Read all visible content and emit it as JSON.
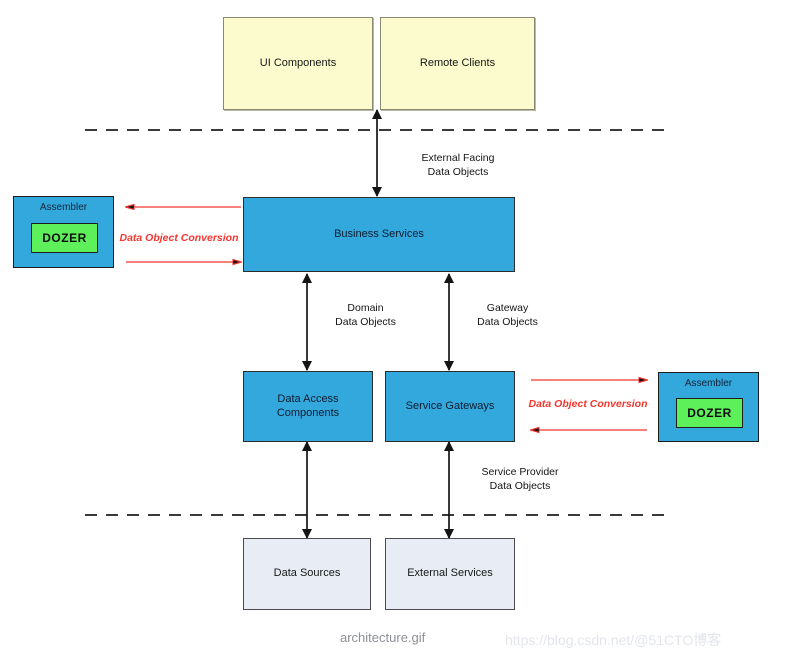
{
  "diagram": {
    "title": "architecture.gif",
    "watermark": "https://blog.csdn.net/@51CTO博客",
    "colors": {
      "yellow_node": "#fbfbcd",
      "blue_node": "#32a8dd",
      "grey_node": "#e7ecf5",
      "dozer_green": "#5ef05a",
      "conversion_red": "#f4362f",
      "connector_black": "#141414",
      "divider_grey": "#3a3a3a"
    },
    "nodes": {
      "ui_components": "UI Components",
      "remote_clients": "Remote Clients",
      "business_services": "Business Services",
      "data_access_components": "Data Access\nComponents",
      "service_gateways": "Service Gateways",
      "data_sources": "Data Sources",
      "external_services": "External Services"
    },
    "assemblers": {
      "left": {
        "title": "Assembler",
        "tool": "DOZER",
        "conversion_label": "Data Object Conversion"
      },
      "right": {
        "title": "Assembler",
        "tool": "DOZER",
        "conversion_label": "Data Object Conversion"
      }
    },
    "connector_labels": {
      "external_facing": "External Facing\nData Objects",
      "domain": "Domain\nData Objects",
      "gateway": "Gateway\nData Objects",
      "service_provider": "Service Provider\nData Objects"
    }
  }
}
